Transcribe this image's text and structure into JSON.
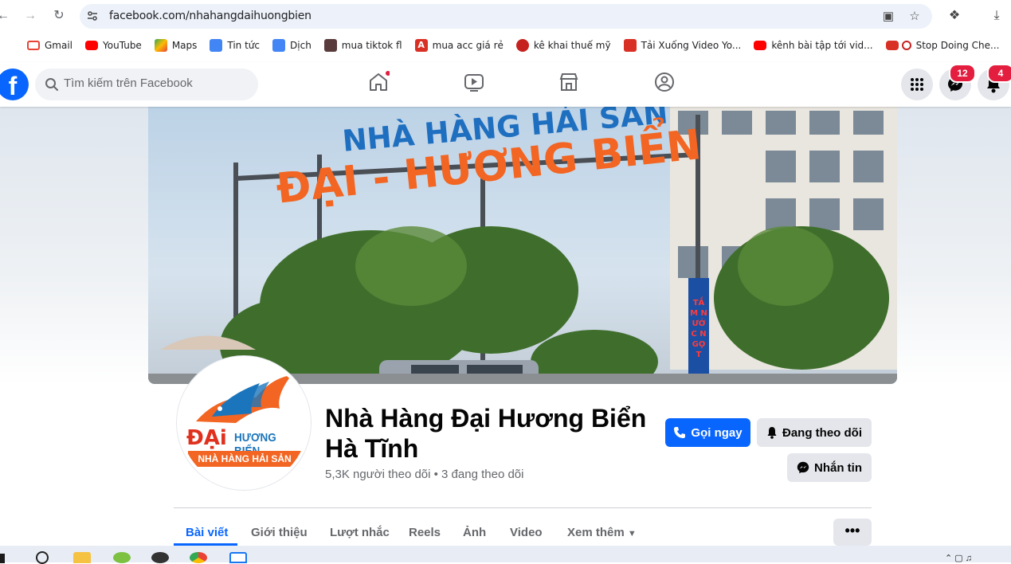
{
  "browser": {
    "url": "facebook.com/nhahangdaihuongbien",
    "bookmarks": [
      {
        "label": "Gmail",
        "color": "#ea4335"
      },
      {
        "label": "YouTube",
        "color": "#ff0000"
      },
      {
        "label": "Maps",
        "color": "#34a853"
      },
      {
        "label": "Tin tức",
        "color": "#4285f4"
      },
      {
        "label": "Dịch",
        "color": "#4285f4"
      },
      {
        "label": "mua tiktok fl",
        "color": "#5a3b3b"
      },
      {
        "label": "mua acc giá rẻ",
        "color": "#d93025"
      },
      {
        "label": "kê khai thuế mỹ",
        "color": "#c5221f"
      },
      {
        "label": "Tải Xuống Video Yo...",
        "color": "#d93025"
      },
      {
        "label": "kênh bài tập tới vid...",
        "color": "#ff0000"
      },
      {
        "label": "Stop Doing Che...",
        "color": "#d93025"
      }
    ]
  },
  "fb": {
    "search_placeholder": "Tìm kiếm trên Facebook",
    "messenger_badge": "12",
    "notifications_badge": "4"
  },
  "cover": {
    "line1": "NHÀ HÀNG HẢI SẢN",
    "line2": "ĐẠI - HƯƠNG BIỂN",
    "sign_text": "TẮM NƯỚC NGỌT"
  },
  "avatar": {
    "brand_dai": "ĐẠi",
    "brand_huong_bien": "HƯƠNG BIỂN",
    "brand_banner": "NHÀ HÀNG HẢI SẢN"
  },
  "page": {
    "name": "Nhà Hàng Đại Hương Biển Hà Tĩnh",
    "stats": "5,3K người theo dõi • 3 đang theo dõi",
    "call_button": "Gọi ngay",
    "follow_button": "Đang theo dõi",
    "message_button": "Nhắn tin"
  },
  "tabs": [
    "Bài viết",
    "Giới thiệu",
    "Lượt nhắc",
    "Reels",
    "Ảnh",
    "Video",
    "Xem thêm"
  ],
  "colors": {
    "fb_blue": "#0866ff",
    "badge_red": "#e41e3f",
    "brand_orange": "#f26522",
    "brand_blue": "#1b75bc"
  }
}
